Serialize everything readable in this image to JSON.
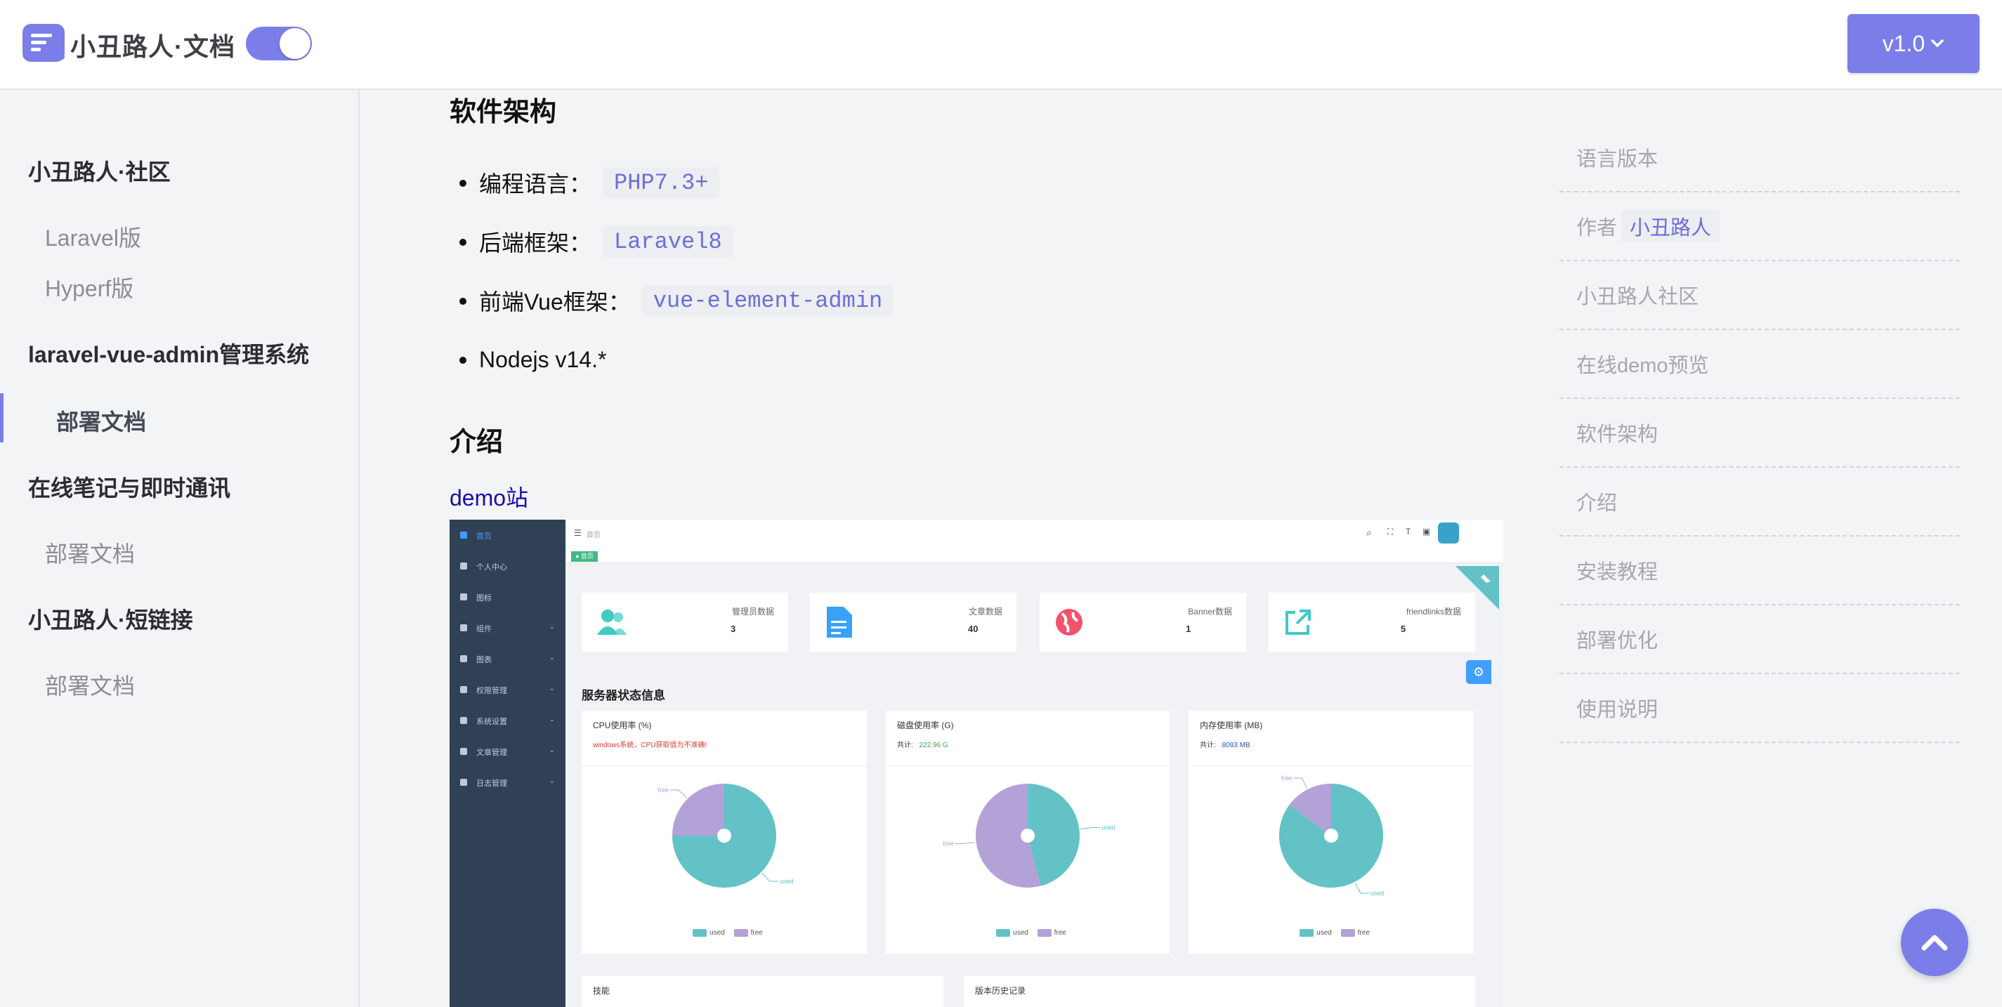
{
  "header": {
    "brand": "小丑路人·文档",
    "version_label": "v1.0",
    "theme_toggle_on": true
  },
  "sidebar": {
    "groups": [
      {
        "title": "小丑路人·社区",
        "items": [
          "Laravel版",
          "Hyperf版"
        ]
      },
      {
        "title": "laravel-vue-admin管理系统",
        "items": [
          "部署文档"
        ],
        "active_item": "部署文档"
      },
      {
        "title": "在线笔记与即时通讯",
        "items": [
          "部署文档"
        ]
      },
      {
        "title": "小丑路人·短链接",
        "items": [
          "部署文档"
        ]
      }
    ]
  },
  "content": {
    "arch_heading": "软件架构",
    "arch_items": [
      {
        "label": "编程语言：",
        "code": "PHP7.3+"
      },
      {
        "label": "后端框架：",
        "code": "Laravel8"
      },
      {
        "label": "前端Vue框架：",
        "code": "vue-element-admin"
      },
      {
        "label": "Nodejs v14.*",
        "code": ""
      }
    ],
    "intro_heading": "介绍",
    "demo_link": "demo站"
  },
  "demo_screenshot": {
    "top_breadcrumb": "首页",
    "tag_home": "● 首页",
    "menu": [
      "首页",
      "个人中心",
      "图标",
      "组件",
      "图表",
      "权限管理",
      "系统设置",
      "文章管理",
      "日志管理"
    ],
    "stats": [
      {
        "label": "管理员数据",
        "value": "3",
        "icon": "users-icon"
      },
      {
        "label": "文章数据",
        "value": "40",
        "icon": "document-icon"
      },
      {
        "label": "Banner数据",
        "value": "1",
        "icon": "globe-icon"
      },
      {
        "label": "friendlinks数据",
        "value": "5",
        "icon": "external-link-icon"
      }
    ],
    "server_status_title": "服务器状态信息",
    "pies": [
      {
        "title": "CPU使用率 (%)",
        "note": "windows系统，CPU获取值为不准确!",
        "used_label": "used",
        "free_label": "free"
      },
      {
        "title": "磁盘使用率 (G)",
        "note_label": "共计:",
        "note_value": "222.96 G",
        "used_label": "used",
        "free_label": "free"
      },
      {
        "title": "内存使用率 (MB)",
        "note_label": "共计:",
        "note_value": "8093 MB",
        "used_label": "used",
        "free_label": "free"
      }
    ],
    "bottom_left": "技能",
    "bottom_right": "版本历史记录",
    "legend_used": "used",
    "legend_free": "free",
    "colors": {
      "used": "#62c2c6",
      "free": "#b2a2d8",
      "sidebar": "#304156",
      "accent": "#409eff"
    }
  },
  "pie_data": [
    {
      "name": "CPU使用率",
      "used": 0.75,
      "free": 0.25
    },
    {
      "name": "磁盘使用率",
      "used": 0.46,
      "free": 0.54
    },
    {
      "name": "内存使用率",
      "used": 0.85,
      "free": 0.15
    }
  ],
  "toc": {
    "items": [
      "语言版本",
      "作者",
      "小丑路人社区",
      "在线demo预览",
      "软件架构",
      "介绍",
      "安装教程",
      "部署优化",
      "使用说明"
    ],
    "author_name": "小丑路人"
  },
  "theme": {
    "accent": "#7b7ee8"
  }
}
